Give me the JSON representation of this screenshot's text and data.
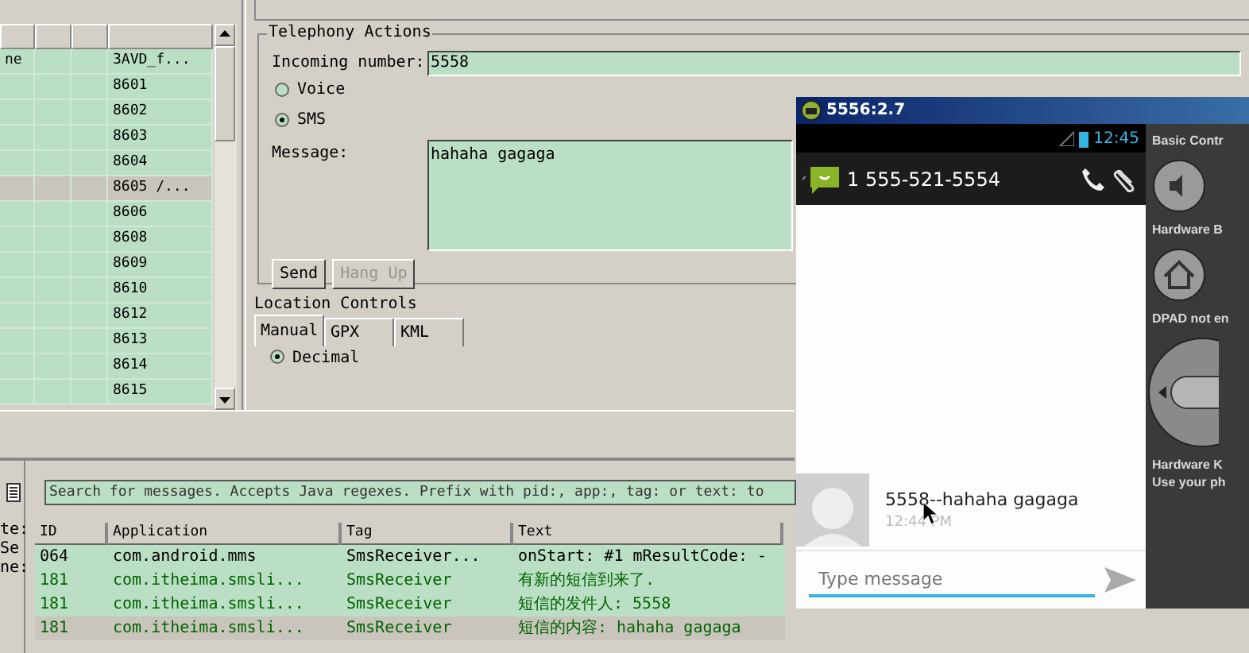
{
  "device_table": {
    "rows": [
      {
        "column_1": "ne",
        "column_4": "3AVD_f...",
        "selected": false
      },
      {
        "column_4": "8601",
        "selected": false
      },
      {
        "column_4": "8602",
        "selected": false
      },
      {
        "column_4": "8603",
        "selected": false
      },
      {
        "column_4": "8604",
        "selected": false
      },
      {
        "column_4": "8605 /...",
        "selected": true
      },
      {
        "column_4": "8606",
        "selected": false
      },
      {
        "column_4": "8608",
        "selected": false
      },
      {
        "column_4": "8609",
        "selected": false
      },
      {
        "column_4": "8610",
        "selected": false
      },
      {
        "column_4": "8612",
        "selected": false
      },
      {
        "column_4": "8613",
        "selected": false
      },
      {
        "column_4": "8614",
        "selected": false
      },
      {
        "column_4": "8615",
        "selected": false
      }
    ]
  },
  "telephony": {
    "title": "Telephony Actions",
    "incoming_label": "Incoming number:",
    "incoming_value": "5558",
    "options": [
      {
        "label": "Voice",
        "selected": false
      },
      {
        "label": "SMS",
        "selected": true
      }
    ],
    "message_label": "Message:",
    "message_value": "hahaha gagaga",
    "buttons": [
      {
        "label": "Send",
        "disabled": false
      },
      {
        "label": "Hang Up",
        "disabled": true
      }
    ]
  },
  "location": {
    "title": "Location Controls",
    "tabs": [
      {
        "label": "Manual",
        "selected": true
      },
      {
        "label": "GPX",
        "selected": false
      },
      {
        "label": "KML",
        "selected": false
      }
    ],
    "format_options": [
      {
        "label": "Decimal",
        "selected": true
      }
    ]
  },
  "logcat": {
    "side_labels": [
      "te:",
      "Se",
      "ne:"
    ],
    "search": {
      "placeholder": "Search for messages. Accepts Java regexes. Prefix with pid:, app:, tag: or text: to"
    },
    "columns": [
      "ID",
      "Application",
      "Tag",
      "Text"
    ],
    "rows": [
      {
        "id": "064",
        "application": "com.android.mms",
        "tag": "SmsReceiver...",
        "text": "onStart: #1 mResultCode: -",
        "color": "#000000",
        "selected": false
      },
      {
        "id": "181",
        "application": "com.itheima.smsli...",
        "tag": "SmsReceiver",
        "text": "有新的短信到来了.",
        "color": "#006400",
        "selected": false
      },
      {
        "id": "181",
        "application": "com.itheima.smsli...",
        "tag": "SmsReceiver",
        "text": "短信的发件人: 5558",
        "color": "#006400",
        "selected": false
      },
      {
        "id": "181",
        "application": "com.itheima.smsli...",
        "tag": "SmsReceiver",
        "text": "短信的内容: hahaha gagaga",
        "color": "#006400",
        "selected": true
      }
    ]
  },
  "emulator": {
    "title": "5556:2.7",
    "clock": "12:45",
    "contact": "1 555-521-5554",
    "messages": [
      {
        "text": "5558--hahaha gagaga",
        "time": "12:44 PM"
      }
    ],
    "compose": {
      "placeholder": "Type message"
    },
    "controls": [
      {
        "kind": "label",
        "text": "Basic Contr"
      },
      {
        "kind": "volume"
      },
      {
        "kind": "label",
        "text": "Hardware B"
      },
      {
        "kind": "home"
      },
      {
        "kind": "label",
        "text": "DPAD not en"
      },
      {
        "kind": "dpad"
      },
      {
        "kind": "label",
        "text": "Hardware K"
      },
      {
        "kind": "label",
        "text": "Use your ph"
      }
    ]
  }
}
